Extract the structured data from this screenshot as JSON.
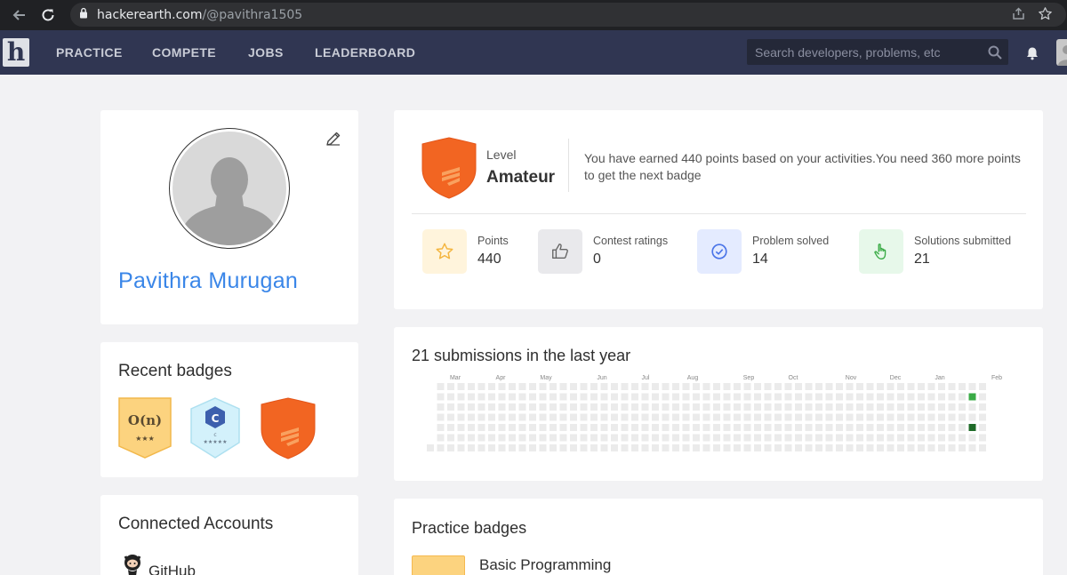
{
  "browser": {
    "url_host": "hackerearth.com",
    "url_path": "/@pavithra1505"
  },
  "nav": {
    "links": [
      "PRACTICE",
      "COMPETE",
      "JOBS",
      "LEADERBOARD"
    ],
    "search_placeholder": "Search developers, problems, etc",
    "colors": {
      "bar": "#303652",
      "search_bg": "#242838"
    }
  },
  "profile": {
    "name": "Pavithra Murugan"
  },
  "recent_badges": {
    "title": "Recent badges",
    "items": [
      {
        "icon": "big-o-badge-icon",
        "text": "O(n)",
        "stars": "★★★",
        "color": "#fcd37f"
      },
      {
        "icon": "c-language-badge-icon",
        "text": "C",
        "subtext": "c",
        "stars": "★★★★★",
        "color": "#cdeffb"
      },
      {
        "icon": "amateur-shield-badge-icon",
        "color": "#f26522"
      }
    ]
  },
  "connected_accounts": {
    "title": "Connected Accounts",
    "items": [
      {
        "icon": "github-octocat-icon",
        "label": "GitHub"
      }
    ]
  },
  "level": {
    "label": "Level",
    "value": "Amateur",
    "message": "You have earned 440 points based on your activities.You need 360 more points to get the next badge",
    "shield_color": "#f26522"
  },
  "stats": [
    {
      "icon": "star-icon",
      "label": "Points",
      "value": "440",
      "tile_color": "#fff4dc"
    },
    {
      "icon": "thumbs-up-icon",
      "label": "Contest ratings",
      "value": "0",
      "tile_color": "#e9e9ec"
    },
    {
      "icon": "check-circle-icon",
      "label": "Problem solved",
      "value": "14",
      "tile_color": "#e4ebff"
    },
    {
      "icon": "hand-pointer-icon",
      "label": "Solutions submitted",
      "value": "21",
      "tile_color": "#e7f8ea"
    }
  ],
  "submissions": {
    "title": "21 submissions in the last year",
    "months": [
      "Mar",
      "Apr",
      "May",
      "Jun",
      "Jul",
      "Aug",
      "Sep",
      "Oct",
      "Nov",
      "Dec",
      "Jan",
      "Feb"
    ],
    "active_cells": [
      {
        "week": 53,
        "day": 1,
        "level": 1
      },
      {
        "week": 53,
        "day": 4,
        "level": 2
      }
    ],
    "colors": {
      "empty": "#ebebeb",
      "level1": "#3aab46",
      "level2": "#1f6b29"
    }
  },
  "practice_badges": {
    "title": "Practice badges",
    "items": [
      {
        "name": "Basic Programming",
        "color": "#fcd37f"
      }
    ]
  }
}
